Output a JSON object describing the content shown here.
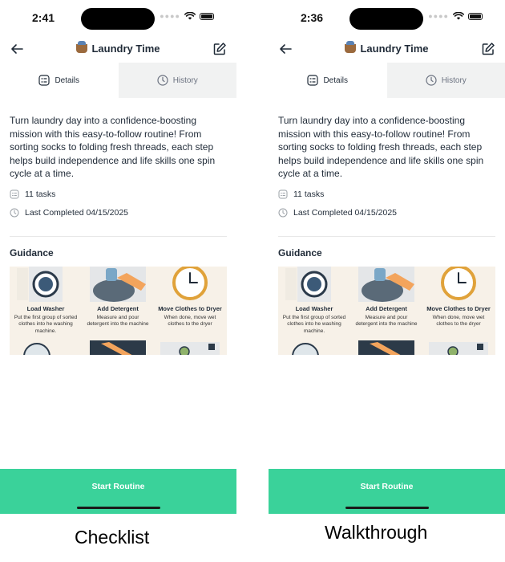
{
  "screens": [
    {
      "caption": "Checklist",
      "status_time": "2:41",
      "nav": {
        "title": "Laundry Time",
        "back_icon": "arrow-left-icon",
        "edit_icon": "edit-icon"
      },
      "tabs": [
        {
          "label": "Details",
          "active": true
        },
        {
          "label": "History",
          "active": false
        }
      ],
      "description": "Turn laundry day into a confidence-boosting mission with this easy-to-follow routine! From sorting socks to folding fresh threads, each step helps build independence and life skills one spin cycle at a time.",
      "tasks_count": "11 tasks",
      "last_completed": "Last Completed 04/15/2025",
      "guidance_heading": "Guidance",
      "guidance_steps": [
        {
          "title": "Load Washer",
          "desc": "Put the first group of sorted clothes into he washing machine."
        },
        {
          "title": "Add Detergent",
          "desc": "Measure and pour detergent into the machine"
        },
        {
          "title": "Move Clothes to Dryer",
          "desc": "When done, move wet clothes to the dryer"
        }
      ],
      "cta_label": "Start Routine"
    },
    {
      "caption": "Walkthrough",
      "status_time": "2:36",
      "nav": {
        "title": "Laundry Time",
        "back_icon": "arrow-left-icon",
        "edit_icon": "edit-icon"
      },
      "tabs": [
        {
          "label": "Details",
          "active": true
        },
        {
          "label": "History",
          "active": false
        }
      ],
      "description": "Turn laundry day into a confidence-boosting mission with this easy-to-follow routine! From sorting socks to folding fresh threads, each step helps build independence and life skills one spin cycle at a time.",
      "tasks_count": "11 tasks",
      "last_completed": "Last Completed 04/15/2025",
      "guidance_heading": "Guidance",
      "guidance_steps": [
        {
          "title": "Load Washer",
          "desc": "Put the first group of sorted clothes into he washing machine."
        },
        {
          "title": "Add Detergent",
          "desc": "Measure and pour detergent into the machine"
        },
        {
          "title": "Move Clothes to Dryer",
          "desc": "When done, move wet clothes to the dryer"
        }
      ],
      "cta_label": "Start Routine"
    }
  ],
  "colors": {
    "accent": "#3ad29a",
    "text": "#1f2a37",
    "muted": "#6b7280",
    "tab_inactive_bg": "#f1f2f2"
  }
}
